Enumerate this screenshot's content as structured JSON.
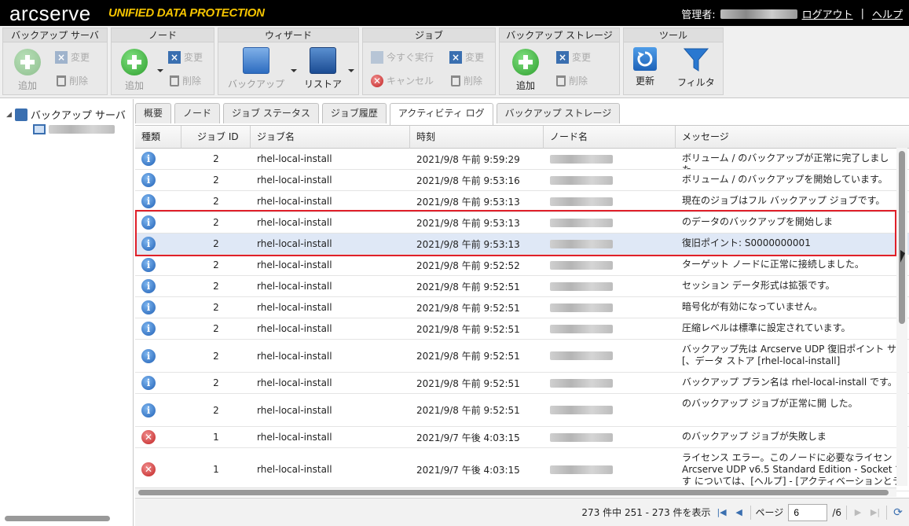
{
  "header": {
    "logo": "arcserve",
    "logo_sub": "UNIFIED DATA PROTECTION",
    "admin_label": "管理者:",
    "logout": "ログアウト",
    "separator": "|",
    "help": "ヘルプ"
  },
  "toolbar": {
    "backup_server": {
      "title": "バックアップ サーバ",
      "add": "追加",
      "modify": "変更",
      "delete": "削除"
    },
    "node": {
      "title": "ノード",
      "add": "追加",
      "modify": "変更",
      "delete": "削除"
    },
    "wizard": {
      "title": "ウィザード",
      "backup": "バックアップ",
      "restore": "リストア"
    },
    "job": {
      "title": "ジョブ",
      "run_now": "今すぐ実行",
      "modify": "変更",
      "cancel": "キャンセル",
      "delete": "削除"
    },
    "backup_storage": {
      "title": "バックアップ ストレージ",
      "add": "追加",
      "modify": "変更",
      "delete": "削除"
    },
    "tools": {
      "title": "ツール",
      "refresh": "更新",
      "filter": "フィルタ"
    }
  },
  "sidebar": {
    "root_label": "バックアップ サーバ"
  },
  "tabs": [
    "概要",
    "ノード",
    "ジョブ ステータス",
    "ジョブ履歴",
    "アクティビティ ログ",
    "バックアップ ストレージ"
  ],
  "active_tab": "アクティビティ ログ",
  "grid": {
    "columns": [
      "種類",
      "ジョブ ID",
      "ジョブ名",
      "時刻",
      "ノード名",
      "メッセージ"
    ],
    "rows": [
      {
        "type": "info",
        "job_id": "2",
        "job_name": "rhel-local-install",
        "time": "2021/9/8 午前 9:59:29",
        "message": "ボリューム / のバックアップが正常に完了しました。"
      },
      {
        "type": "info",
        "job_id": "2",
        "job_name": "rhel-local-install",
        "time": "2021/9/8 午前 9:53:16",
        "message": "ボリューム / のバックアップを開始しています。"
      },
      {
        "type": "info",
        "job_id": "2",
        "job_name": "rhel-local-install",
        "time": "2021/9/8 午前 9:53:13",
        "message": "現在のジョブはフル バックアップ ジョブです。"
      },
      {
        "type": "info",
        "job_id": "2",
        "job_name": "rhel-local-install",
        "time": "2021/9/8 午前 9:53:13",
        "message": "のデータのバックアップを開始しま"
      },
      {
        "type": "info",
        "job_id": "2",
        "job_name": "rhel-local-install",
        "time": "2021/9/8 午前 9:53:13",
        "message": "復旧ポイント: S0000000001"
      },
      {
        "type": "info",
        "job_id": "2",
        "job_name": "rhel-local-install",
        "time": "2021/9/8 午前 9:52:52",
        "message": "ターゲット ノードに正常に接続しました。"
      },
      {
        "type": "info",
        "job_id": "2",
        "job_name": "rhel-local-install",
        "time": "2021/9/8 午前 9:52:51",
        "message": "セッション データ形式は拡張です。"
      },
      {
        "type": "info",
        "job_id": "2",
        "job_name": "rhel-local-install",
        "time": "2021/9/8 午前 9:52:51",
        "message": "暗号化が有効になっていません。"
      },
      {
        "type": "info",
        "job_id": "2",
        "job_name": "rhel-local-install",
        "time": "2021/9/8 午前 9:52:51",
        "message": "圧縮レベルは標準に設定されています。"
      },
      {
        "type": "info",
        "job_id": "2",
        "job_name": "rhel-local-install",
        "time": "2021/9/8 午前 9:52:51",
        "message": "バックアップ先は Arcserve UDP 復旧ポイント サ [、データ ストア [rhel-local-install]"
      },
      {
        "type": "info",
        "job_id": "2",
        "job_name": "rhel-local-install",
        "time": "2021/9/8 午前 9:52:51",
        "message": "バックアップ プラン名は rhel-local-install です。"
      },
      {
        "type": "info",
        "job_id": "2",
        "job_name": "rhel-local-install",
        "time": "2021/9/8 午前 9:52:51",
        "message": "のバックアップ ジョブが正常に開 した。"
      },
      {
        "type": "error",
        "job_id": "1",
        "job_name": "rhel-local-install",
        "time": "2021/9/7 午後 4:03:15",
        "message": "のバックアップ ジョブが失敗しま"
      },
      {
        "type": "error",
        "job_id": "1",
        "job_name": "rhel-local-install",
        "time": "2021/9/7 午後 4:03:15",
        "message": "ライセンス エラー。このノードに必要なライセン Arcserve UDP v6.5 Standard Edition - Socket です については、[ヘルプ] - [アクティベーションとラ"
      }
    ]
  },
  "pager": {
    "summary": "273 件中 251 - 273 件を表示",
    "page_label": "ページ",
    "page_value": "6",
    "page_total": "/6"
  }
}
